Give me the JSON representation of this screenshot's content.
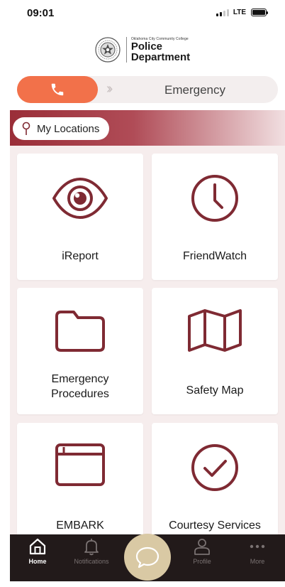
{
  "status_bar": {
    "time": "09:01",
    "network": "LTE"
  },
  "header": {
    "org_small": "Oklahoma City Community College",
    "title_line1": "Police",
    "title_line2": "Department"
  },
  "emergency": {
    "label": "Emergency",
    "icon": "phone-icon"
  },
  "locations": {
    "label": "My Locations",
    "icon": "map-pin-icon"
  },
  "tiles": [
    {
      "label": "iReport",
      "icon": "eye-icon"
    },
    {
      "label": "FriendWatch",
      "icon": "clock-icon"
    },
    {
      "label_line1": "Emergency",
      "label_line2": "Procedures",
      "icon": "folder-icon"
    },
    {
      "label": "Safety Map",
      "icon": "map-icon"
    },
    {
      "label": "EMBARK",
      "icon": "browser-window-icon"
    },
    {
      "label": "Courtesy Services",
      "icon": "check-circle-icon"
    }
  ],
  "nav": {
    "home": "Home",
    "notifications": "Notifications",
    "profile": "Profile",
    "more": "More"
  },
  "colors": {
    "accent": "#7f2a33",
    "emergency_orange": "#f2714a",
    "nav_background": "#221a1a",
    "chat_button": "#d9c9a4",
    "tile_background": "#f6eded"
  }
}
